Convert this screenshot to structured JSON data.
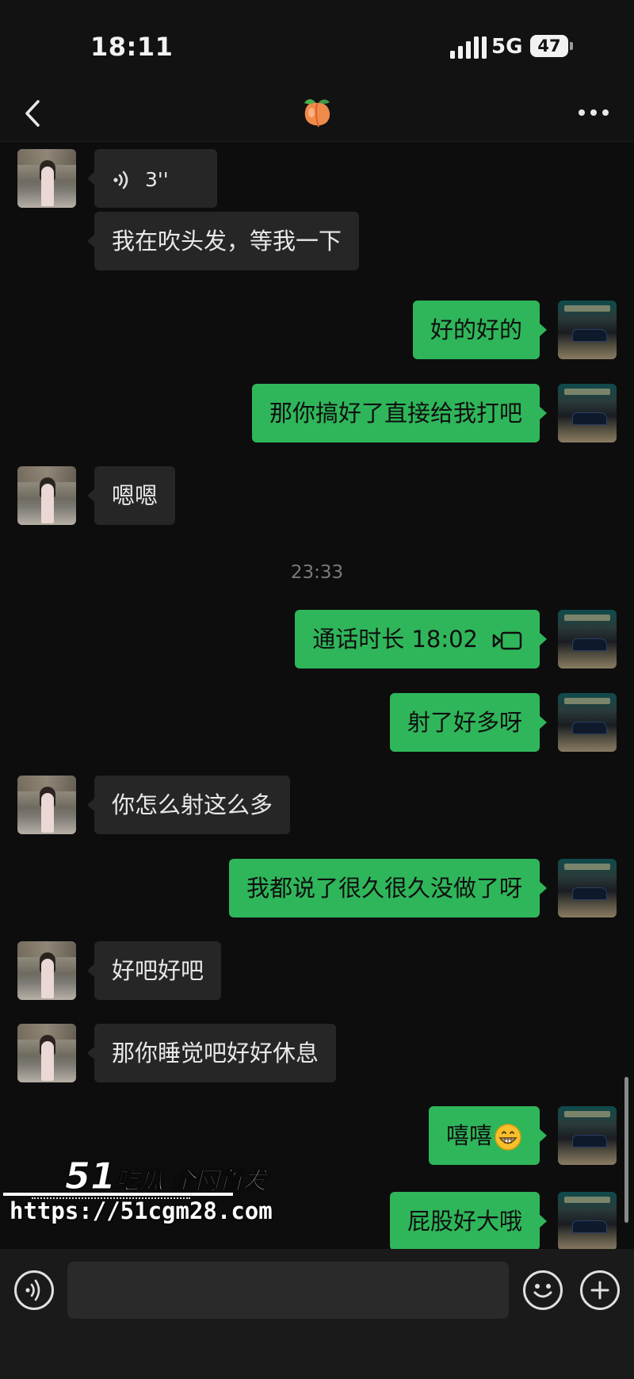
{
  "status_bar": {
    "time": "18:11",
    "network": "5G",
    "battery_level": "47",
    "icons": [
      "signal-icon",
      "battery-icon"
    ]
  },
  "nav": {
    "back_icon": "chevron-left-icon",
    "title_icon": "peach-emoji-icon",
    "more_icon": "more-dots-icon"
  },
  "messages": [
    {
      "side": "in",
      "type": "voice",
      "duration": "3''"
    },
    {
      "side": "in",
      "type": "text",
      "text": "我在吹头发，等我一下"
    },
    {
      "side": "out",
      "type": "text",
      "text": "好的好的"
    },
    {
      "side": "out",
      "type": "text",
      "text": "那你搞好了直接给我打吧"
    },
    {
      "side": "in",
      "type": "text",
      "text": "嗯嗯"
    },
    {
      "type": "timestamp",
      "text": "23:33"
    },
    {
      "side": "out",
      "type": "call",
      "text": "通话时长 18:02"
    },
    {
      "side": "out",
      "type": "text",
      "text": "射了好多呀"
    },
    {
      "side": "in",
      "type": "text",
      "text": "你怎么射这么多"
    },
    {
      "side": "out",
      "type": "text",
      "text": "我都说了很久很久没做了呀"
    },
    {
      "side": "in",
      "type": "text",
      "text": "好吧好吧"
    },
    {
      "side": "in",
      "type": "text",
      "text": "那你睡觉吧好好休息"
    },
    {
      "side": "out",
      "type": "text",
      "text": "嘻嘻",
      "emoji": "grinning-face-emoji-icon"
    },
    {
      "side": "out",
      "type": "text",
      "text": "屁股好大哦"
    }
  ],
  "watermark": {
    "brand_number": "51",
    "brand_text": "吃瓜 全网首发",
    "url": "https://51cgm28.com"
  },
  "input_bar": {
    "voice_icon": "voice-input-icon",
    "emoji_icon": "emoji-smile-icon",
    "add_icon": "plus-circle-icon",
    "input_value": ""
  },
  "colors": {
    "background": "#0d0d0d",
    "incoming_bubble": "#262626",
    "outgoing_bubble": "#2fb65a",
    "timestamp": "#7a7a7a"
  }
}
